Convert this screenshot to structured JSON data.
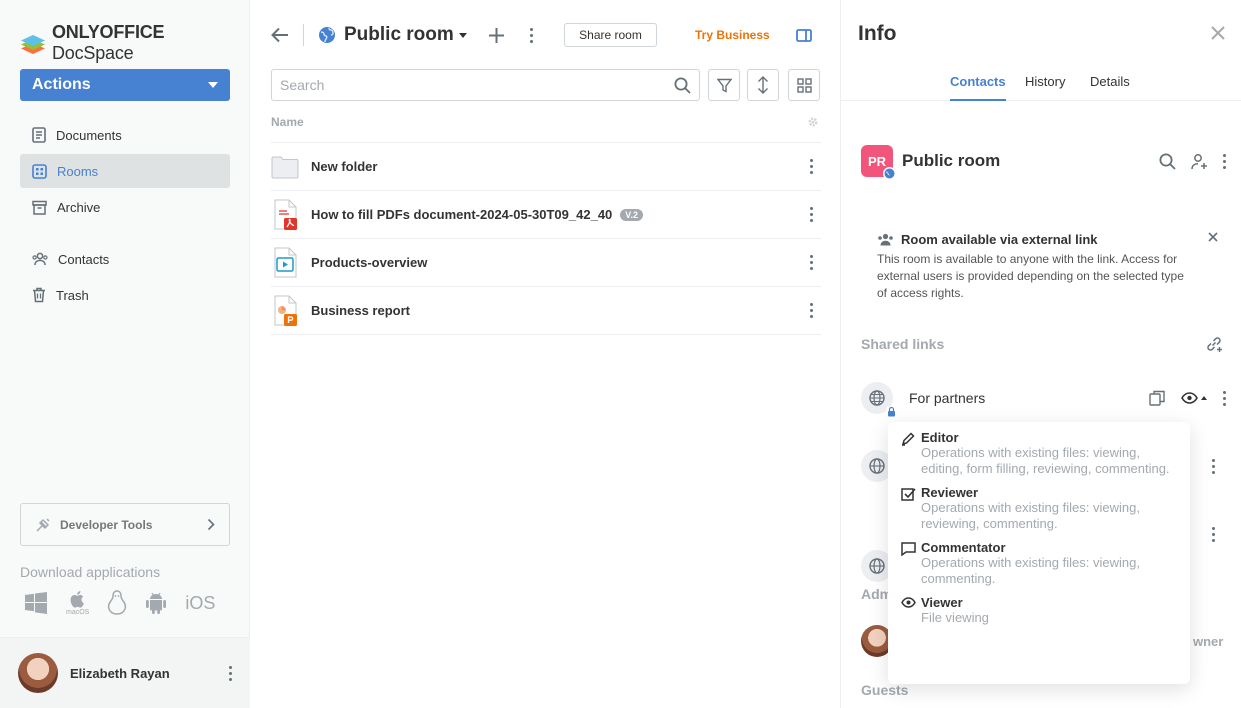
{
  "brand": {
    "name_bold": "ONLYOFFICE",
    "name_rest": " DocSpace"
  },
  "sidebar": {
    "actions_label": "Actions",
    "items": [
      {
        "label": "Documents",
        "icon": "documents-icon"
      },
      {
        "label": "Rooms",
        "icon": "rooms-icon",
        "active": true
      },
      {
        "label": "Archive",
        "icon": "archive-icon"
      },
      {
        "label": "Contacts",
        "icon": "contacts-icon"
      },
      {
        "label": "Trash",
        "icon": "trash-icon"
      }
    ],
    "developer_tools": "Developer Tools",
    "download_label": "Download applications",
    "apps": [
      "windows-icon",
      "macos-icon",
      "linux-icon",
      "android-icon",
      "ios-icon"
    ],
    "macos_caption": "macOS",
    "ios_caption": "iOS",
    "user_name": "Elizabeth Rayan"
  },
  "main": {
    "room_title": "Public room",
    "share_room": "Share room",
    "try_business": "Try Business",
    "search_placeholder": "Search",
    "column_name": "Name",
    "files": [
      {
        "name": "New folder",
        "type": "folder"
      },
      {
        "name": "How to fill PDFs document-2024-05-30T09_42_40",
        "type": "pdf",
        "version": "V.2"
      },
      {
        "name": "Products-overview",
        "type": "video"
      },
      {
        "name": "Business report",
        "type": "presentation"
      }
    ]
  },
  "info": {
    "title": "Info",
    "tabs": [
      "Contacts",
      "History",
      "Details"
    ],
    "active_tab": "Contacts",
    "room_initials": "PR",
    "room_name": "Public room",
    "notice_title": "Room available via external link",
    "notice_text": "This room is available to anyone with the link. Access for external users is provided depending on the selected type of access rights.",
    "shared_links_label": "Shared links",
    "link_name": "For partners",
    "admins_label_partial": "Adm",
    "owner_partial": "wner",
    "guests_label": "Guests"
  },
  "access_menu": [
    {
      "title": "Editor",
      "icon": "pencil-icon",
      "desc": "Operations with existing files: viewing, editing, form filling, reviewing, commenting."
    },
    {
      "title": "Reviewer",
      "icon": "review-check-icon",
      "desc": "Operations with existing files: viewing, reviewing, commenting."
    },
    {
      "title": "Commentator",
      "icon": "comment-icon",
      "desc": "Operations with existing files: viewing, commenting."
    },
    {
      "title": "Viewer",
      "icon": "eye-icon",
      "desc": "File viewing"
    }
  ],
  "colors": {
    "accent": "#4781d1",
    "business": "#ed7309",
    "room_badge": "#f2557c",
    "muted": "#a3a9ae"
  }
}
